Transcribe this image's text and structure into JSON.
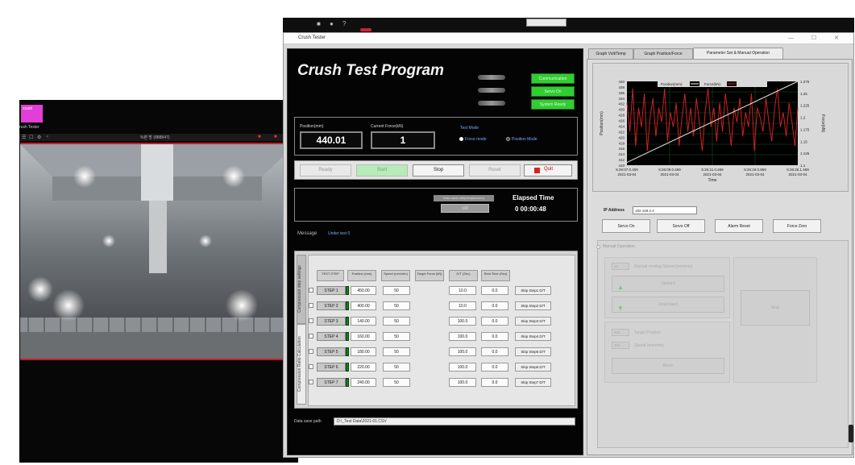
{
  "camera_window": {
    "app_icon_text": "crush",
    "app_title": "rush Tester",
    "toolbar_title": "%본 방 (888847)",
    "colors": {
      "frame_accent": "#c21f2a",
      "logo": "#e23fd8"
    }
  },
  "main_window": {
    "title": "Crush Tester",
    "app_title": "Crush Test Program",
    "status_buttons": [
      "Communication",
      "Servo On",
      "System Ready"
    ],
    "readouts": {
      "position_label": "Position(mm)",
      "position_value": "440.01",
      "force_label": "Current Force(kN)",
      "force_value": "1",
      "test_mode_label": "Test Mode",
      "mode_options": [
        "Force mode",
        "Position Mode"
      ],
      "selected_mode": "Force mode"
    },
    "controls": {
      "ready": "Ready",
      "start": "Start",
      "stop": "Stop",
      "reset": "Reset",
      "quit": "Quit"
    },
    "timing": {
      "rate_label": "Data save rate(samples/sec)",
      "rate_value": "100",
      "elapsed_label": "Elapsed Time",
      "elapsed_value": "0  00:00:48"
    },
    "message": {
      "label": "Message",
      "value": "Under test 0"
    },
    "step_table": {
      "side_tabs": [
        "Compression step settings",
        "Compression Ratio Calculation"
      ],
      "headers": [
        "TEST STEP",
        "Position (mm)",
        "Speed (mm/min)",
        "Target Force (kN)",
        "D/T (Sec)",
        "Rest Time (Sec)"
      ],
      "rows": [
        {
          "step": "STEP 1",
          "position": "450.00",
          "speed": "50",
          "dt": "10.0",
          "rest": "0.0",
          "skip": "Skip Step1 D/T"
        },
        {
          "step": "STEP 2",
          "position": "400.00",
          "speed": "50",
          "dt": "10.0",
          "rest": "0.0",
          "skip": "Skip Step2 D/T"
        },
        {
          "step": "STEP 3",
          "position": "140.00",
          "speed": "50",
          "dt": "100.0",
          "rest": "0.0",
          "skip": "Skip Step3 D/T"
        },
        {
          "step": "STEP 4",
          "position": "160.00",
          "speed": "50",
          "dt": "100.0",
          "rest": "0.0",
          "skip": "Skip Step4 D/T"
        },
        {
          "step": "STEP 5",
          "position": "180.00",
          "speed": "50",
          "dt": "100.0",
          "rest": "0.0",
          "skip": "Skip Step5 D/T"
        },
        {
          "step": "STEP 6",
          "position": "220.00",
          "speed": "50",
          "dt": "100.0",
          "rest": "0.0",
          "skip": "Skip Step6 D/T"
        },
        {
          "step": "STEP 7",
          "position": "240.00",
          "speed": "50",
          "dt": "100.0",
          "rest": "0.0",
          "skip": "Skip Step7 D/T"
        }
      ]
    },
    "save_path": {
      "label": "Data save path",
      "value": "D:\\_Test Data\\2021-01.CSV"
    }
  },
  "right_panel": {
    "tabs": [
      "Graph Volt/Temp",
      "Graph Position/Force",
      "Parameter Set & Manual Operation"
    ],
    "selected_tab": "Parameter Set & Manual Operation",
    "ip": {
      "label": "IP Address",
      "value": "192.168.2.4"
    },
    "servo_buttons": [
      "Servo On",
      "Servo Off",
      "Alarm Reset",
      "Force Zero"
    ],
    "manual": {
      "label": "Manual Operation",
      "speed_label": "Manual moving Speed (mm/min)",
      "speed_value": "10",
      "upward": "Upward",
      "downward": "Downward",
      "target_label": "Target Position",
      "target_value": "400",
      "speed2_label": "Speed (mm/min)",
      "speed2_value": "100",
      "move": "Move",
      "stop": "Stop"
    }
  },
  "chart_data": {
    "type": "line",
    "xlabel": "Time",
    "ylabel": "Position(mm)",
    "y2label": "Force(kN)",
    "legend": [
      {
        "name": "Position(mm)",
        "color": "#ffffff"
      },
      {
        "name": "Force(kN)",
        "color": "#cc2222"
      }
    ],
    "legend_position": "top-center",
    "grid": true,
    "ylim": [
      410,
      440
    ],
    "y_ticks": [
      "440",
      "438",
      "436",
      "434",
      "432",
      "430",
      "428",
      "426",
      "424",
      "422",
      "420",
      "418",
      "416",
      "414",
      "412",
      "410"
    ],
    "y2lim": [
      1.1,
      1.275
    ],
    "y2_ticks": [
      "1.275",
      "1.25",
      "1.225",
      "1.2",
      "1.175",
      "1.15",
      "1.125",
      "1.1"
    ],
    "x_ticks": [
      [
        "5:26:07.0.469",
        "2021-03-04"
      ],
      [
        "5:26:09.0.469",
        "2021-03-04"
      ],
      [
        "5:26:11.0.469",
        "2021-03-04"
      ],
      [
        "5:26:19.0.869",
        "2021-03-04"
      ],
      [
        "5:26:25.1.469",
        "2021-03-04"
      ]
    ],
    "series": [
      {
        "name": "Position(mm)",
        "values": [
          411,
          440
        ]
      },
      {
        "name": "Force(kN)",
        "values": [
          1.23,
          1.17,
          1.26,
          1.14,
          1.22,
          1.18,
          1.25,
          1.13,
          1.2,
          1.24,
          1.16,
          1.22,
          1.19,
          1.26,
          1.15,
          1.21,
          1.18,
          1.23,
          1.14,
          1.2,
          1.25,
          1.17,
          1.22,
          1.16,
          1.24,
          1.19,
          1.13,
          1.21,
          1.26,
          1.18,
          1.22,
          1.15,
          1.23,
          1.17,
          1.25,
          1.2,
          1.14,
          1.22,
          1.19,
          1.24,
          1.16,
          1.21,
          1.18,
          1.25,
          1.13,
          1.22,
          1.2,
          1.17,
          1.24,
          1.19,
          1.15,
          1.22,
          1.26,
          1.18,
          1.21,
          1.16,
          1.23,
          1.19,
          1.14,
          1.22
        ]
      }
    ]
  }
}
